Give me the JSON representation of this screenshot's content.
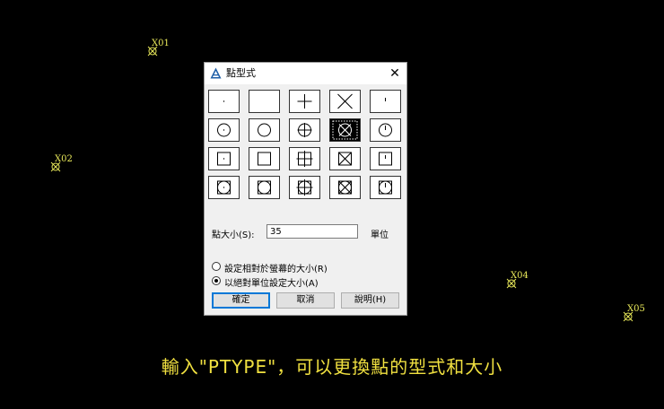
{
  "points": [
    {
      "label": "X01"
    },
    {
      "label": "X02"
    },
    {
      "label": "X04"
    },
    {
      "label": "X05"
    }
  ],
  "dialog": {
    "title": "點型式",
    "close_symbol": "✕",
    "size_label": "點大小(S):",
    "size_value": "35",
    "unit_label": "單位",
    "radio_relative": "設定相對於螢幕的大小(R)",
    "radio_absolute": "以絕對單位設定大小(A)",
    "selected_radio": "absolute",
    "selected_style_index": 8,
    "ok_label": "確定",
    "cancel_label": "取消",
    "help_label": "說明(H)"
  },
  "colors": {
    "marker": "#e8e85a",
    "caption": "#f0e040",
    "accent": "#0078d7"
  },
  "caption": "輸入\"PTYPE\"，可以更換點的型式和大小"
}
